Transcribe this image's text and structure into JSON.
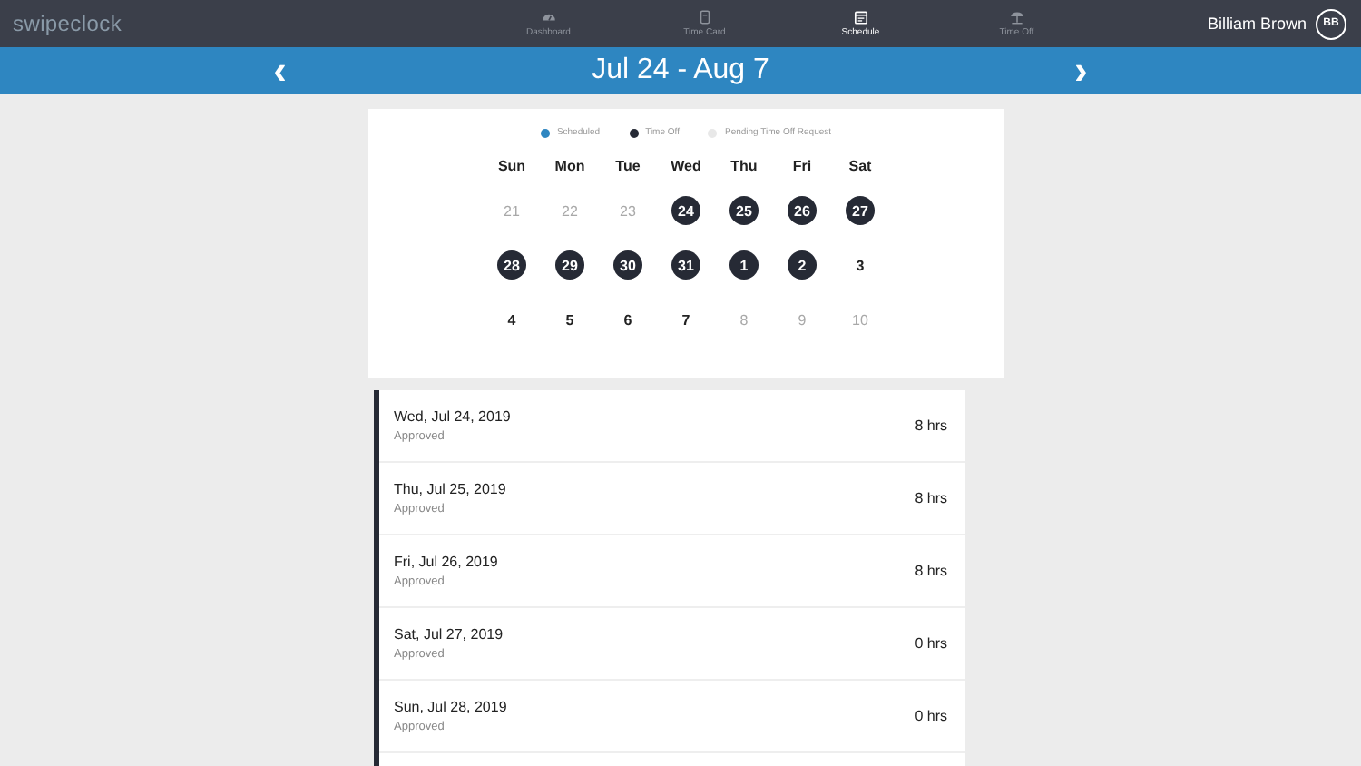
{
  "brand": "swipeclock",
  "nav": [
    {
      "label": "Dashboard",
      "selected": false
    },
    {
      "label": "Time Card",
      "selected": false
    },
    {
      "label": "Schedule",
      "selected": true
    },
    {
      "label": "Time Off",
      "selected": false
    }
  ],
  "user": {
    "name": "Billiam Brown",
    "initials": "BB"
  },
  "period": {
    "prev": "‹",
    "title": "Jul 24 - Aug 7",
    "next": "›"
  },
  "legend": [
    {
      "label": "Scheduled",
      "color": "#2e86c1"
    },
    {
      "label": "Time Off",
      "color": "#262a35"
    },
    {
      "label": "Pending Time Off Request",
      "color": "#e8e8e8"
    }
  ],
  "weekdays": [
    "Sun",
    "Mon",
    "Tue",
    "Wed",
    "Thu",
    "Fri",
    "Sat"
  ],
  "weeks": [
    [
      {
        "day": "21",
        "kind": "outside"
      },
      {
        "day": "22",
        "kind": "outside"
      },
      {
        "day": "23",
        "kind": "outside"
      },
      {
        "day": "24",
        "kind": "timeoff"
      },
      {
        "day": "25",
        "kind": "timeoff"
      },
      {
        "day": "26",
        "kind": "timeoff"
      },
      {
        "day": "27",
        "kind": "timeoff"
      }
    ],
    [
      {
        "day": "28",
        "kind": "timeoff"
      },
      {
        "day": "29",
        "kind": "timeoff"
      },
      {
        "day": "30",
        "kind": "timeoff"
      },
      {
        "day": "31",
        "kind": "timeoff"
      },
      {
        "day": "1",
        "kind": "timeoff"
      },
      {
        "day": "2",
        "kind": "timeoff"
      },
      {
        "day": "3",
        "kind": "normal"
      }
    ],
    [
      {
        "day": "4",
        "kind": "normal"
      },
      {
        "day": "5",
        "kind": "normal"
      },
      {
        "day": "6",
        "kind": "normal"
      },
      {
        "day": "7",
        "kind": "normal"
      },
      {
        "day": "8",
        "kind": "outside"
      },
      {
        "day": "9",
        "kind": "outside"
      },
      {
        "day": "10",
        "kind": "outside"
      }
    ]
  ],
  "entries": [
    {
      "date": "Wed, Jul 24, 2019",
      "status": "Approved",
      "hours": "8 hrs"
    },
    {
      "date": "Thu, Jul 25, 2019",
      "status": "Approved",
      "hours": "8 hrs"
    },
    {
      "date": "Fri, Jul 26, 2019",
      "status": "Approved",
      "hours": "8 hrs"
    },
    {
      "date": "Sat, Jul 27, 2019",
      "status": "Approved",
      "hours": "0 hrs"
    },
    {
      "date": "Sun, Jul 28, 2019",
      "status": "Approved",
      "hours": "0 hrs"
    }
  ]
}
